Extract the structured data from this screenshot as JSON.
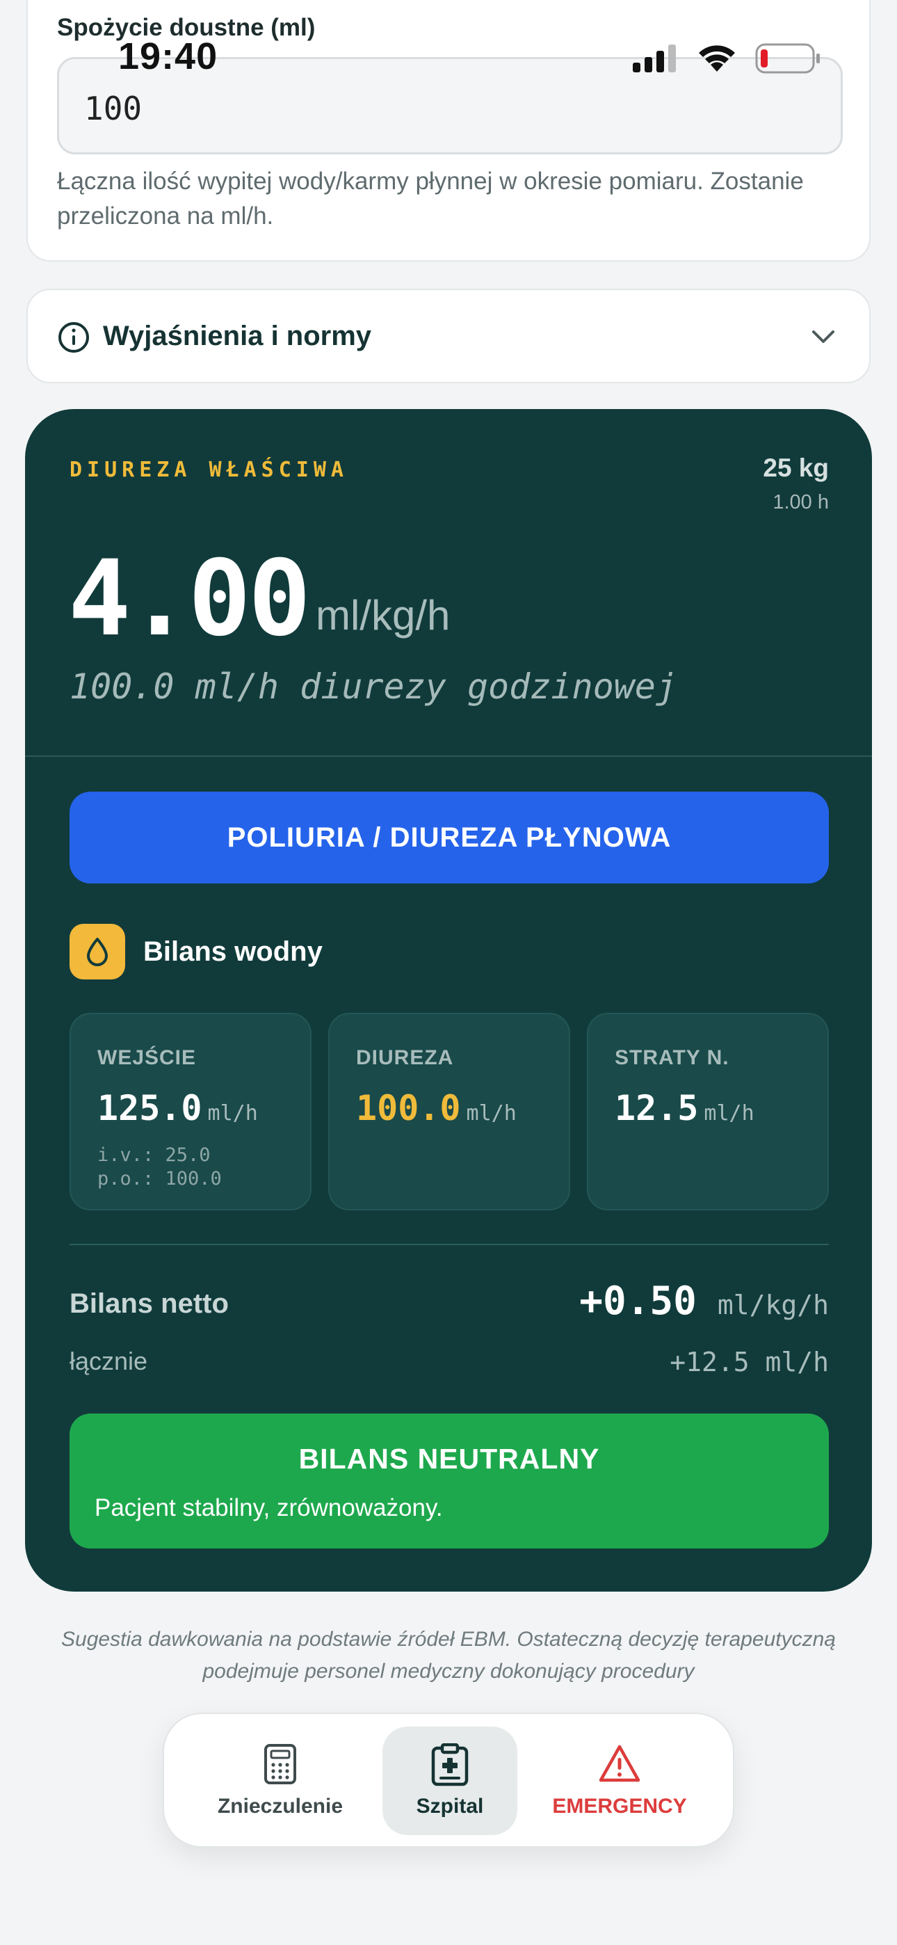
{
  "status_bar": {
    "time": "19:40"
  },
  "intake": {
    "label": "Spożycie doustne (ml)",
    "value": "100",
    "help": "Łączna ilość wypitej wody/karmy płynnej w okresie pomiaru. Zostanie przeliczona na ml/h."
  },
  "explanations": {
    "title": "Wyjaśnienia i normy"
  },
  "result": {
    "eyebrow": "DIUREZA WŁAŚCIWA",
    "weight": "25 kg",
    "duration": "1.00 h",
    "value": "4.00",
    "unit": "ml/kg/h",
    "subline": "100.0 ml/h diurezy godzinowej",
    "classification": "POLIURIA / DIUREZA PŁYNOWA"
  },
  "balance": {
    "title": "Bilans wodny",
    "cards": [
      {
        "label": "WEJŚCIE",
        "value": "125.0",
        "unit": "ml/h",
        "sub1": "i.v.: 25.0",
        "sub2": "p.o.: 100.0"
      },
      {
        "label": "DIUREZA",
        "value": "100.0",
        "unit": "ml/h"
      },
      {
        "label": "STRATY N.",
        "value": "12.5",
        "unit": "ml/h"
      }
    ],
    "net_label": "Bilans netto",
    "net_value": "+0.50",
    "net_unit": "ml/kg/h",
    "total_label": "łącznie",
    "total_value": "+12.5 ml/h",
    "status_title": "BILANS NEUTRALNY",
    "status_sub": "Pacjent stabilny, zrównoważony."
  },
  "disclaimer": "Sugestia dawkowania na podstawie źródeł EBM. Ostateczną decyzję terapeutyczną podejmuje personel medyczny dokonujący procedury",
  "tabs": [
    {
      "label": "Znieczulenie",
      "icon": "calculator-icon"
    },
    {
      "label": "Szpital",
      "icon": "hospital-clipboard-icon"
    },
    {
      "label": "EMERGENCY",
      "icon": "warning-triangle-icon"
    }
  ],
  "colors": {
    "accent_gold": "#f0bb3a",
    "classification_blue": "#2563eb",
    "status_green": "#1ea84d",
    "emergency_red": "#dc3c3c",
    "panel_bg": "#113b3b"
  }
}
